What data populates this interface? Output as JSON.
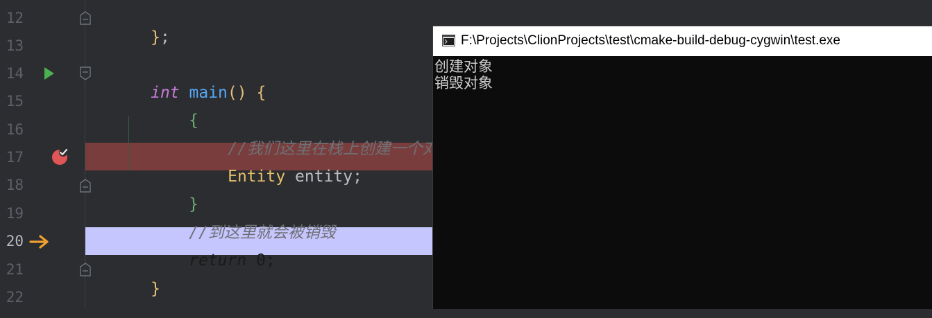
{
  "editor": {
    "lines": [
      {
        "num": "12"
      },
      {
        "num": "13"
      },
      {
        "num": "14"
      },
      {
        "num": "15"
      },
      {
        "num": "16"
      },
      {
        "num": "17"
      },
      {
        "num": "18"
      },
      {
        "num": "19"
      },
      {
        "num": "20"
      },
      {
        "num": "21"
      },
      {
        "num": "22"
      }
    ],
    "code": {
      "l12_brace": "}",
      "l12_semicolon": ";",
      "l14_kw": "int",
      "l14_fn": "main",
      "l14_parens": "()",
      "l14_brace": "{",
      "l15_brace": "{",
      "l16_comment": "//我们这里在栈上创建一个对象",
      "l17_type": "Entity",
      "l17_rest": " entity;",
      "l18_brace": "}",
      "l19_comment": "//到这里就会被销毁",
      "l20_kw": "return",
      "l20_rest": " 0;",
      "l21_brace": "}"
    },
    "colors": {
      "breakpoint_line": "#7a3d3d",
      "execution_line": "#c6c6ff",
      "run_arrow": "#4caf50",
      "breakpoint": "#e05555",
      "execution_pointer": "#f0a030"
    }
  },
  "console": {
    "title": "F:\\Projects\\ClionProjects\\test\\cmake-build-debug-cygwin\\test.exe",
    "output": [
      "创建对象",
      "销毁对象"
    ]
  }
}
